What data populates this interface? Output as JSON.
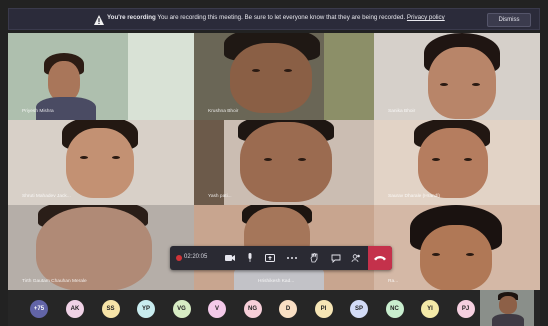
{
  "banner": {
    "title": "You're recording",
    "message": "You are recording this meeting. Be sure to let everyone know that they are being recorded.",
    "link": "Privacy policy",
    "dismiss": "Dismiss"
  },
  "tiles": [
    {
      "name": "Priyesh Mishra",
      "bg": "#b8c7b4"
    },
    {
      "name": "Krushna Bhoir",
      "bg": "#6f6b5c"
    },
    {
      "name": "Sanika Bhoir",
      "bg": "#d8d2cc"
    },
    {
      "name": "Shruti Mahadev Jack...",
      "bg": "#d8cfc8"
    },
    {
      "name": "Yash pati...",
      "bg": "#cdbfb5"
    },
    {
      "name": "Saurav Dharale (Hrandl)",
      "bg": "#e3d3c7"
    },
    {
      "name": "Tirth Gautam Chauhan Merale",
      "bg": "#b7b0aa"
    },
    {
      "name": "Hrishikesh Kad...",
      "bg": "#c9a58e"
    },
    {
      "name": "Ra...",
      "bg": "#d6b9a8"
    }
  ],
  "toolbar": {
    "timer": "02:20:05",
    "items": [
      "video-icon",
      "mic-icon",
      "share-icon",
      "more-icon",
      "raise-hand-icon",
      "chat-icon",
      "participants-icon"
    ],
    "hangup": "hang-up-icon"
  },
  "participants": {
    "overflow": "+75",
    "avatars": [
      {
        "initials": "AK",
        "color": "#f0d2e6"
      },
      {
        "initials": "SS",
        "color": "#f7e4a8"
      },
      {
        "initials": "YP",
        "color": "#c8ecef"
      },
      {
        "initials": "VG",
        "color": "#d7ecc4"
      },
      {
        "initials": "V",
        "color": "#f3c9e9"
      },
      {
        "initials": "NG",
        "color": "#f7cfd9"
      },
      {
        "initials": "D",
        "color": "#f9dfc4"
      },
      {
        "initials": "PI",
        "color": "#f6e5b5"
      },
      {
        "initials": "SP",
        "color": "#d3dcf7"
      },
      {
        "initials": "NC",
        "color": "#c9eecf"
      },
      {
        "initials": "YI",
        "color": "#f4eaa8"
      },
      {
        "initials": "PJ",
        "color": "#f5cfe0"
      }
    ]
  }
}
